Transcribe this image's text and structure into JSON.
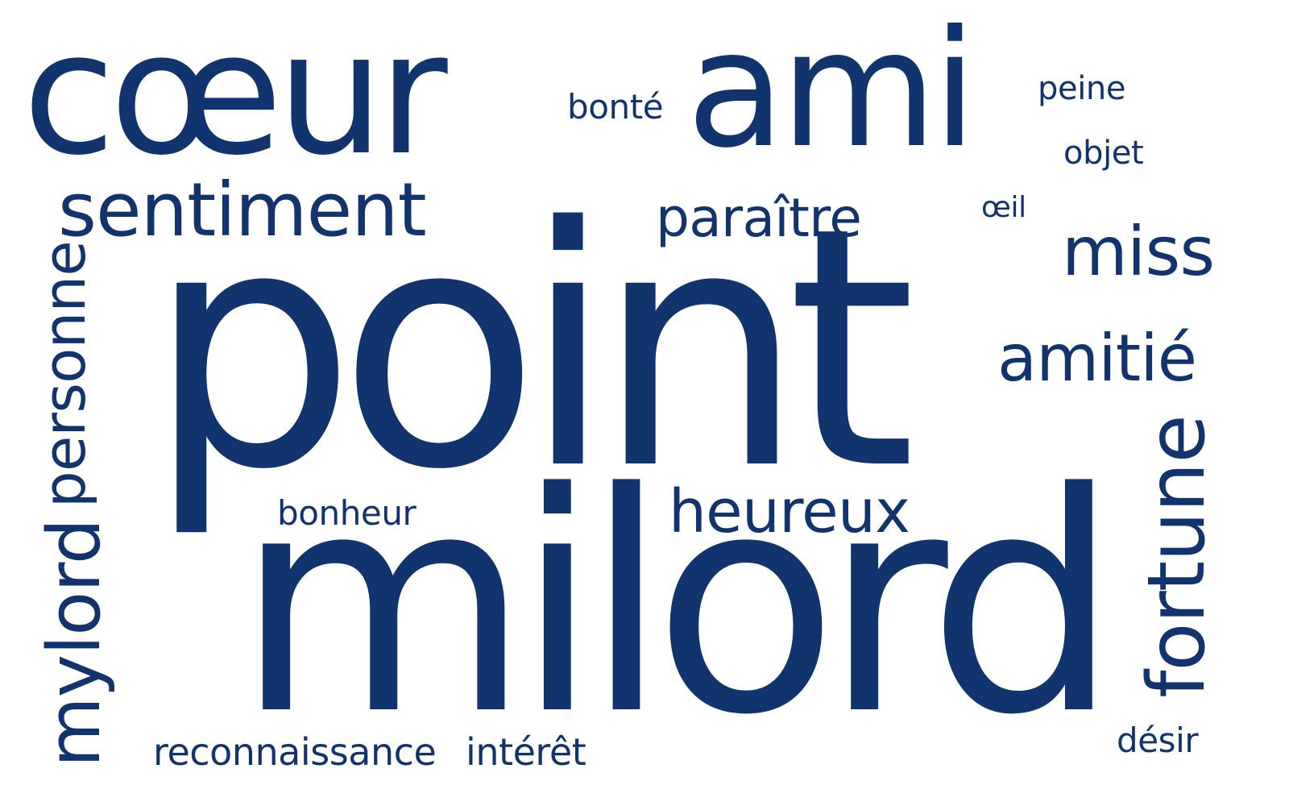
{
  "cloud": {
    "color": "#11346e",
    "background": "#ffffff",
    "words": {
      "point": "point",
      "milord": "milord",
      "coeur": "cœur",
      "ami": "ami",
      "sentiment": "sentiment",
      "mylord": "mylord",
      "personne": "personne",
      "fortune": "fortune",
      "miss": "miss",
      "amitie": "amitié",
      "heureux": "heureux",
      "paraitre": "paraître",
      "bonte": "bonté",
      "peine": "peine",
      "objet": "objet",
      "oeil": "œil",
      "bonheur": "bonheur",
      "reconnaissance": "reconnaissance",
      "interet": "intérêt",
      "desir": "désir"
    }
  }
}
